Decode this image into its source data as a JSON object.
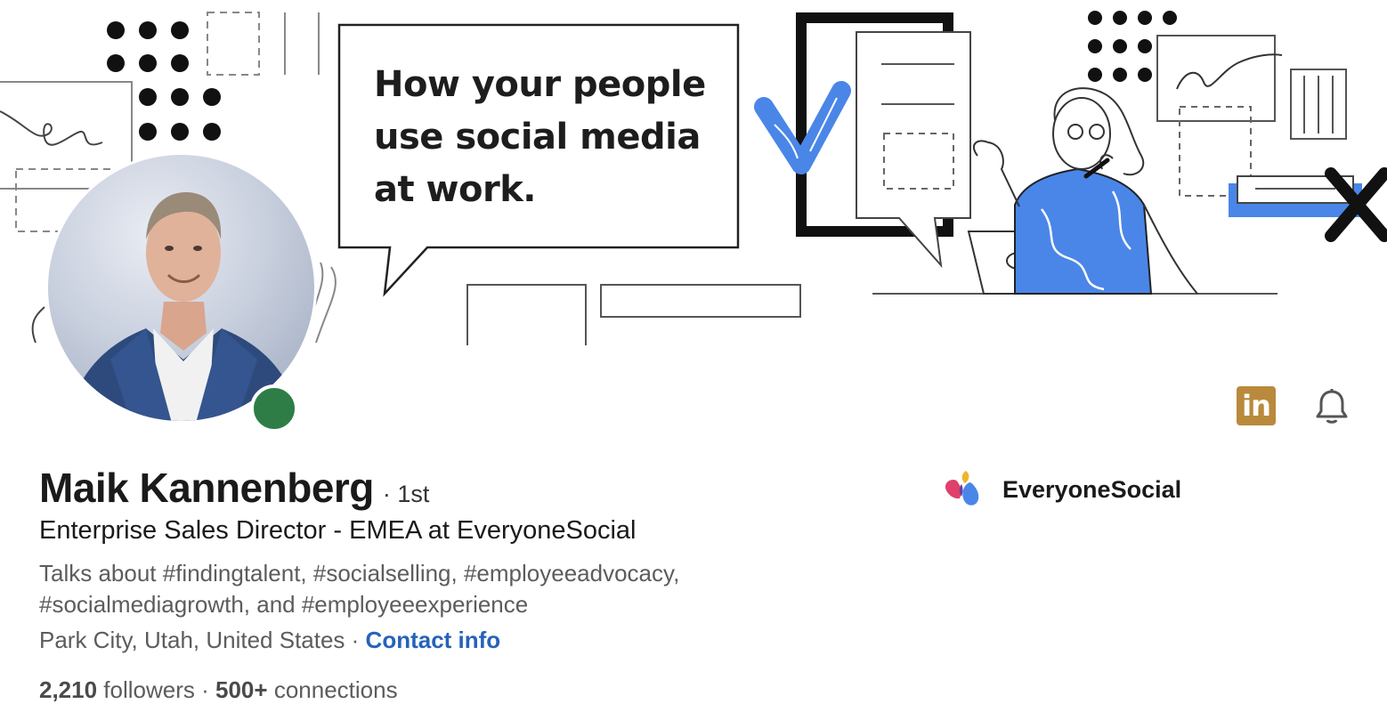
{
  "banner": {
    "headline_lines": [
      "How your people",
      "use social media",
      "at work."
    ]
  },
  "profile": {
    "name": "Maik Kannenberg",
    "degree": "· 1st",
    "headline": "Enterprise Sales Director - EMEA at EveryoneSocial",
    "talks_line1": "Talks about #findingtalent, #socialselling, #employeeadvocacy,",
    "talks_line2": "#socialmediagrowth, and #employeeexperience",
    "location": "Park City, Utah, United States",
    "separator": " · ",
    "contact_label": "Contact info",
    "followers_count": "2,210",
    "followers_label": " followers",
    "stats_separator": "  · ",
    "connections_count": "500+",
    "connections_label": " connections"
  },
  "actions": {
    "linkedin_label": "in",
    "linkedin_icon": "linkedin-icon",
    "bell_icon": "bell-icon"
  },
  "company": {
    "name": "EveryoneSocial",
    "icon": "everyonesocial-logo"
  },
  "colors": {
    "status_online": "#2f7d46",
    "link": "#2563b8",
    "linkedin_badge": "#b98a3c",
    "banner_accent": "#4a86e8"
  }
}
